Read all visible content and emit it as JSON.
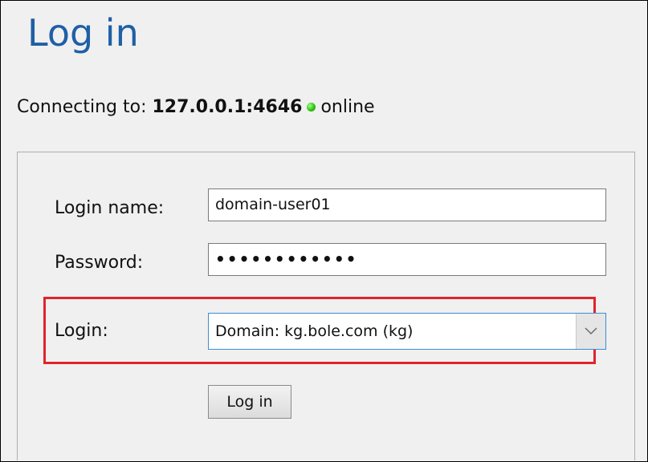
{
  "header": {
    "title": "Log in"
  },
  "connection": {
    "prefix": "Connecting to:",
    "address": "127.0.0.1:4646",
    "status": "online",
    "status_color": "#2fc40e"
  },
  "form": {
    "login_name_label": "Login name:",
    "login_name_value": "domain-user01",
    "password_label": "Password:",
    "password_value": "••••••••••••",
    "login_label": "Login:",
    "login_selected": "Domain: kg.bole.com (kg)",
    "submit_label": "Log in"
  },
  "highlight": {
    "color": "#e0242b"
  }
}
